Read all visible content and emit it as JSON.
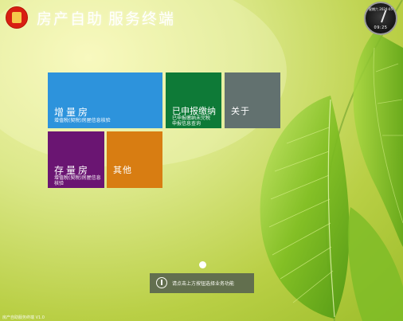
{
  "header": {
    "title_part1": "房产自助",
    "title_part2": "服务终端"
  },
  "clock": {
    "top_label": "星期六 2024-05",
    "time_label": "09:25"
  },
  "tiles": {
    "zlf": {
      "title": "增量房",
      "subtitle": "增值税(契税)房屋信息核验"
    },
    "ysb": {
      "title": "已申报缴纳",
      "subtitle": "已申报缴纳未完税\n申报信息查询"
    },
    "about": {
      "title": "关于"
    },
    "clf": {
      "title": "存量房",
      "subtitle": "增值税(契税)房屋信息\n核验"
    },
    "other": {
      "title": "其他"
    }
  },
  "help": {
    "text": "请点击上方按钮选择业务功能"
  },
  "footer": {
    "version": "房产自助服务终端 V1.0"
  },
  "colors": {
    "zlf": "#2d93dc",
    "ysb": "#0e7a37",
    "about": "#62716f",
    "clf": "#6a1572",
    "other": "#d87d12"
  }
}
